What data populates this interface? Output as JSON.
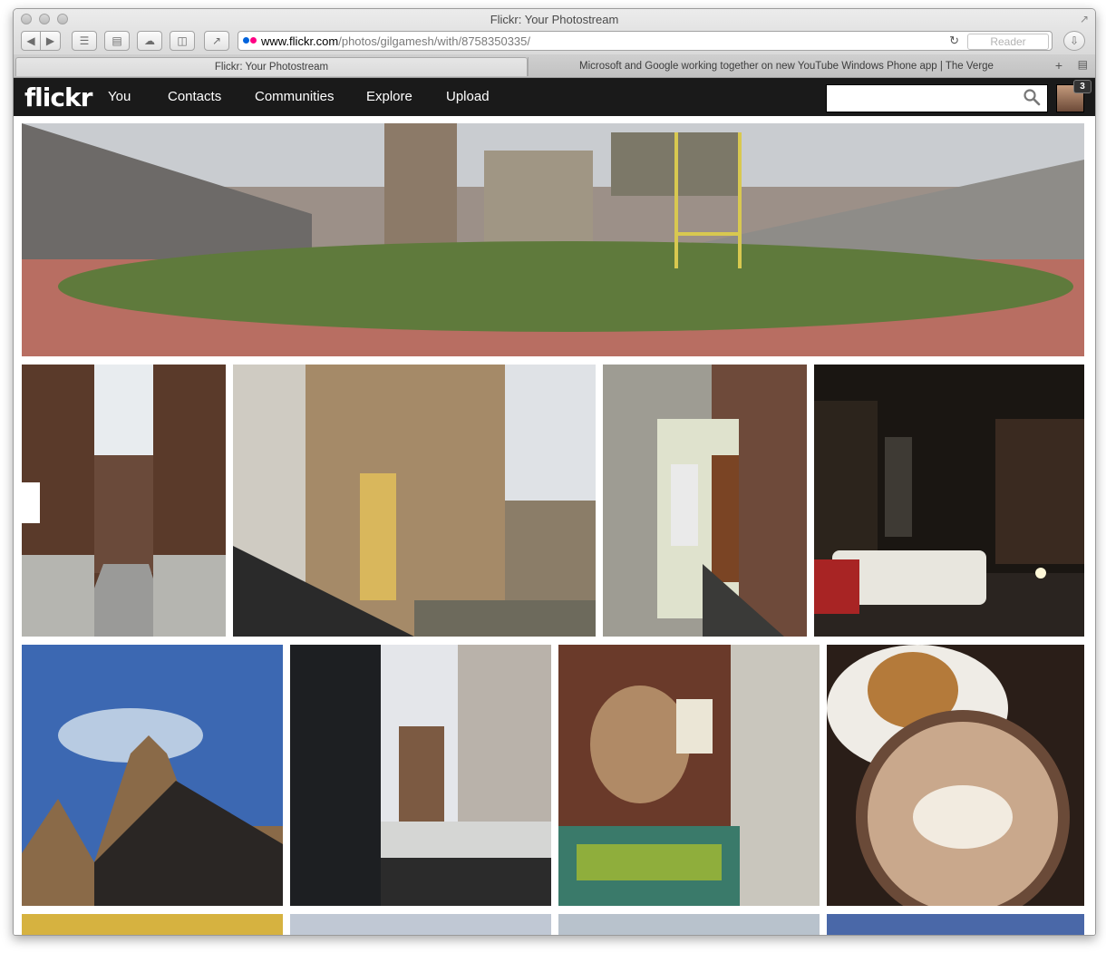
{
  "window": {
    "title": "Flickr: Your Photostream"
  },
  "toolbar": {
    "back_icon": "back-arrow-icon",
    "forward_icon": "forward-arrow-icon",
    "url_host": "www.flickr.com",
    "url_path": "/photos/gilgamesh/with/8758350335/",
    "reader_label": "Reader"
  },
  "tabs": [
    {
      "label": "Flickr: Your Photostream",
      "active": true
    },
    {
      "label": "Microsoft and Google working together on new YouTube Windows Phone app | The Verge",
      "active": false
    }
  ],
  "flickr": {
    "logo": "flickr",
    "nav": [
      "You",
      "Contacts",
      "Communities",
      "Explore",
      "Upload"
    ],
    "search_placeholder": "",
    "notification_count": "3"
  },
  "photos": [
    {
      "name": "stadium-panorama"
    },
    {
      "name": "brick-alley"
    },
    {
      "name": "stone-rowhouses"
    },
    {
      "name": "ornate-doorway"
    },
    {
      "name": "police-night-scene"
    },
    {
      "name": "church-spires"
    },
    {
      "name": "highrise-buildings"
    },
    {
      "name": "graffiti-wall"
    },
    {
      "name": "latte-and-muffin"
    }
  ]
}
